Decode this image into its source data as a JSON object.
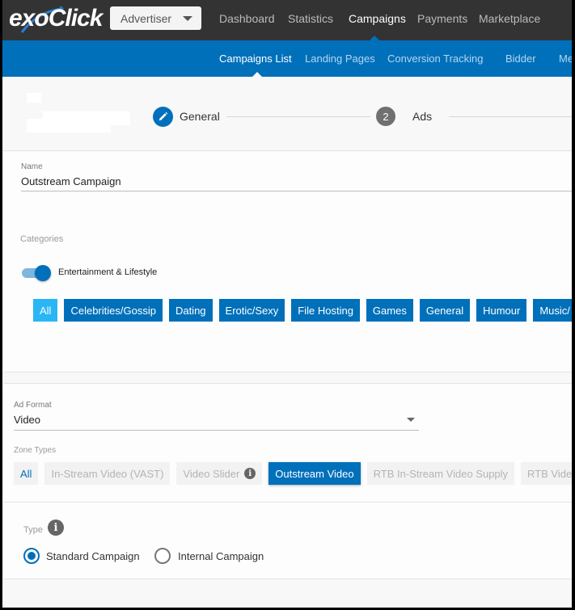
{
  "brand": {
    "logo_text": "exoClick",
    "accent": "#0070ba"
  },
  "account_switcher": {
    "label": "Advertiser"
  },
  "main_nav": [
    {
      "label": "Dashboard",
      "active": false
    },
    {
      "label": "Statistics",
      "active": false
    },
    {
      "label": "Campaigns",
      "active": true
    },
    {
      "label": "Payments",
      "active": false
    },
    {
      "label": "Marketplace",
      "active": false
    }
  ],
  "sub_nav": [
    {
      "label": "Campaigns List",
      "active": true
    },
    {
      "label": "Landing Pages",
      "active": false
    },
    {
      "label": "Conversion Tracking",
      "active": false
    },
    {
      "label": "Bidder",
      "active": false
    },
    {
      "label": "Me",
      "active": false
    }
  ],
  "stepper": {
    "steps": [
      {
        "label": "General",
        "icon": "pencil-icon",
        "state": "current"
      },
      {
        "label": "Ads",
        "number": "2",
        "state": "pending"
      }
    ]
  },
  "general": {
    "name_label": "Name",
    "name_value": "Outstream Campaign",
    "categories_label": "Categories",
    "toggle_label": "Entertainment & Lifestyle",
    "toggle_on": true,
    "category_chips": [
      "All",
      "Celebrities/Gossip",
      "Dating",
      "Erotic/Sexy",
      "File Hosting",
      "Games",
      "General",
      "Humour",
      "Music/"
    ]
  },
  "ad_format": {
    "label": "Ad Format",
    "value": "Video",
    "zone_types_label": "Zone Types",
    "zone_types": [
      {
        "label": "All",
        "state": "all"
      },
      {
        "label": "In-Stream Video (VAST)",
        "state": "disabled"
      },
      {
        "label": "Video Slider",
        "state": "disabled",
        "info": true
      },
      {
        "label": "Outstream Video",
        "state": "selected"
      },
      {
        "label": "RTB In-Stream Video Supply",
        "state": "disabled"
      },
      {
        "label": "RTB Video S",
        "state": "disabled"
      }
    ]
  },
  "type": {
    "label": "Type",
    "info_glyph": "i",
    "options": [
      {
        "label": "Standard Campaign",
        "checked": true
      },
      {
        "label": "Internal Campaign",
        "checked": false
      }
    ]
  }
}
